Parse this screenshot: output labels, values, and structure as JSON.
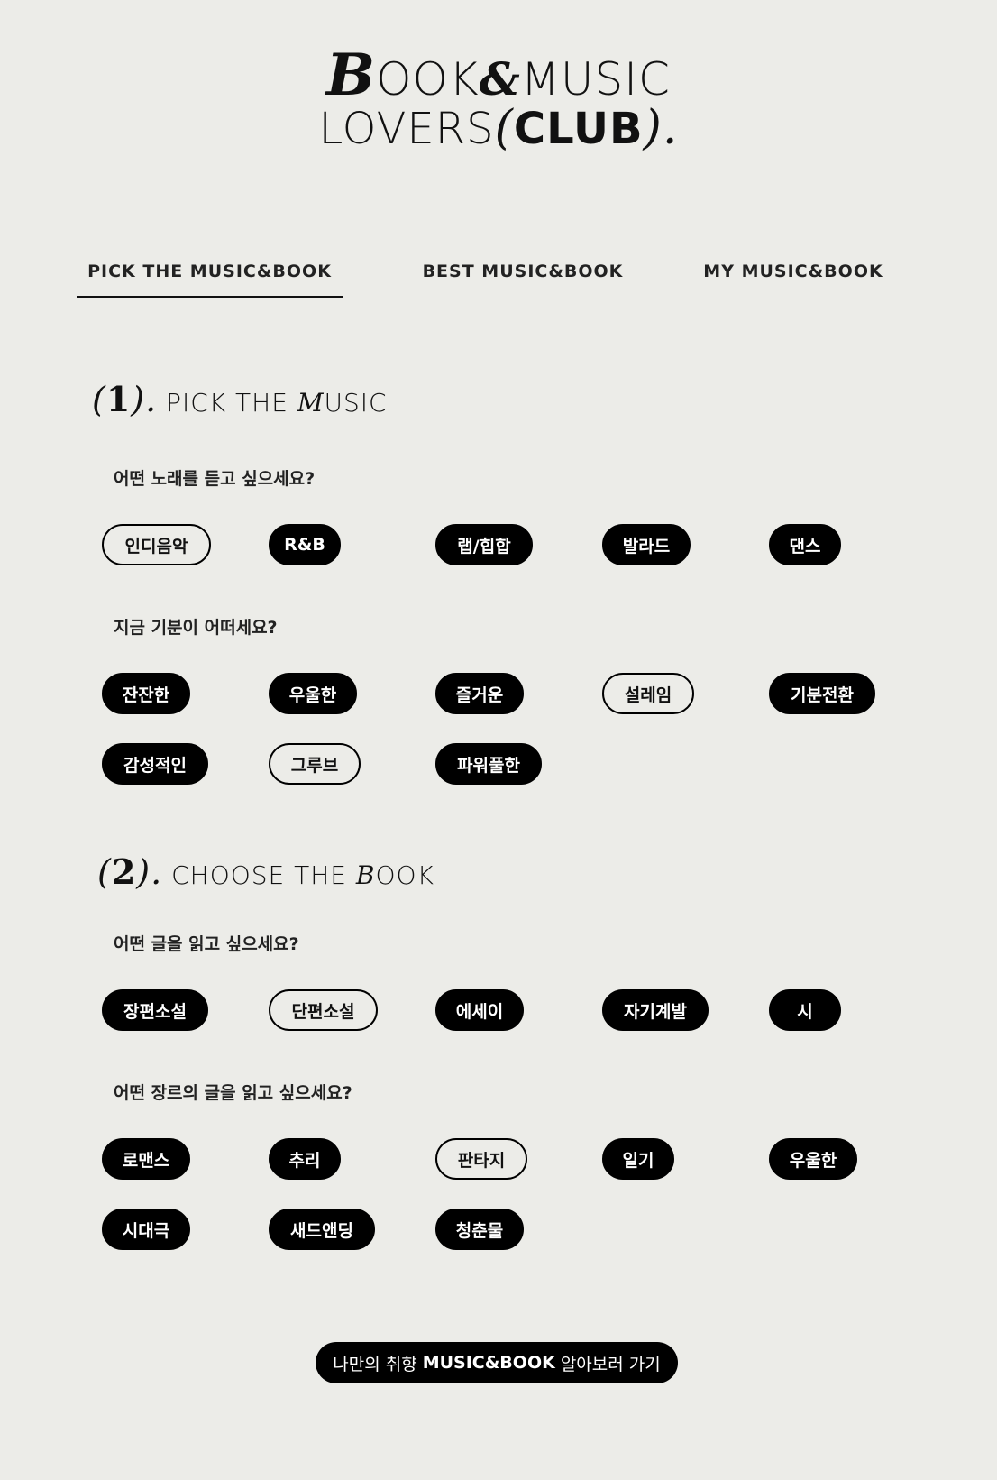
{
  "logo": {
    "line1_b": "B",
    "line1_rest_a": "OOK",
    "line1_amp": "&",
    "line1_rest_b": "MUSIC",
    "line2_a": "LOVERS",
    "line2_open": "(",
    "line2_club": "CLUB",
    "line2_close": ").",
    "text": "BOOK&MUSIC LOVERS (CLUB)."
  },
  "tabs": [
    {
      "label": "PICK THE MUSIC&BOOK",
      "active": true
    },
    {
      "label": "BEST MUSIC&BOOK",
      "active": false
    },
    {
      "label": "MY MUSIC&BOOK",
      "active": false
    }
  ],
  "music": {
    "num_open": "(",
    "num": "1",
    "num_close": ").",
    "title_a": "PICK THE ",
    "title_fancy": "M",
    "title_b": "USIC",
    "q1": "어떤 노래를 듣고 싶으세요?",
    "genres": [
      {
        "label": "인디음악",
        "selected": false
      },
      {
        "label": "R&B",
        "selected": true
      },
      {
        "label": "랩/힙합",
        "selected": true
      },
      {
        "label": "발라드",
        "selected": true
      },
      {
        "label": "댄스",
        "selected": true
      }
    ],
    "q2": "지금 기분이 어떠세요?",
    "moods": [
      {
        "label": "잔잔한",
        "selected": true
      },
      {
        "label": "우울한",
        "selected": true
      },
      {
        "label": "즐거운",
        "selected": true
      },
      {
        "label": "설레임",
        "selected": false
      },
      {
        "label": "기분전환",
        "selected": true
      },
      {
        "label": "감성적인",
        "selected": true
      },
      {
        "label": "그루브",
        "selected": false
      },
      {
        "label": "파워풀한",
        "selected": true
      }
    ]
  },
  "book": {
    "num_open": "(",
    "num": "2",
    "num_close": ").",
    "title_a": "CHOOSE THE ",
    "title_fancy": "B",
    "title_b": "OOK",
    "q1": "어떤 글을 읽고 싶으세요?",
    "types": [
      {
        "label": "장편소설",
        "selected": true
      },
      {
        "label": "단편소설",
        "selected": false
      },
      {
        "label": "에세이",
        "selected": true
      },
      {
        "label": "자기계발",
        "selected": true
      },
      {
        "label": "시",
        "selected": true
      }
    ],
    "q2": "어떤 장르의 글을 읽고 싶으세요?",
    "genres": [
      {
        "label": "로맨스",
        "selected": true
      },
      {
        "label": "추리",
        "selected": true
      },
      {
        "label": "판타지",
        "selected": false
      },
      {
        "label": "일기",
        "selected": true
      },
      {
        "label": "우울한",
        "selected": true
      },
      {
        "label": "시대극",
        "selected": true
      },
      {
        "label": "새드앤딩",
        "selected": true
      },
      {
        "label": "청춘물",
        "selected": true
      }
    ]
  },
  "cta": {
    "prefix": "나만의 취향",
    "bold": "MUSIC&BOOK",
    "suffix": "알아보러 가기"
  },
  "colors": {
    "background": "#ecece8",
    "pill_selected": "#000000",
    "text": "#111111"
  }
}
